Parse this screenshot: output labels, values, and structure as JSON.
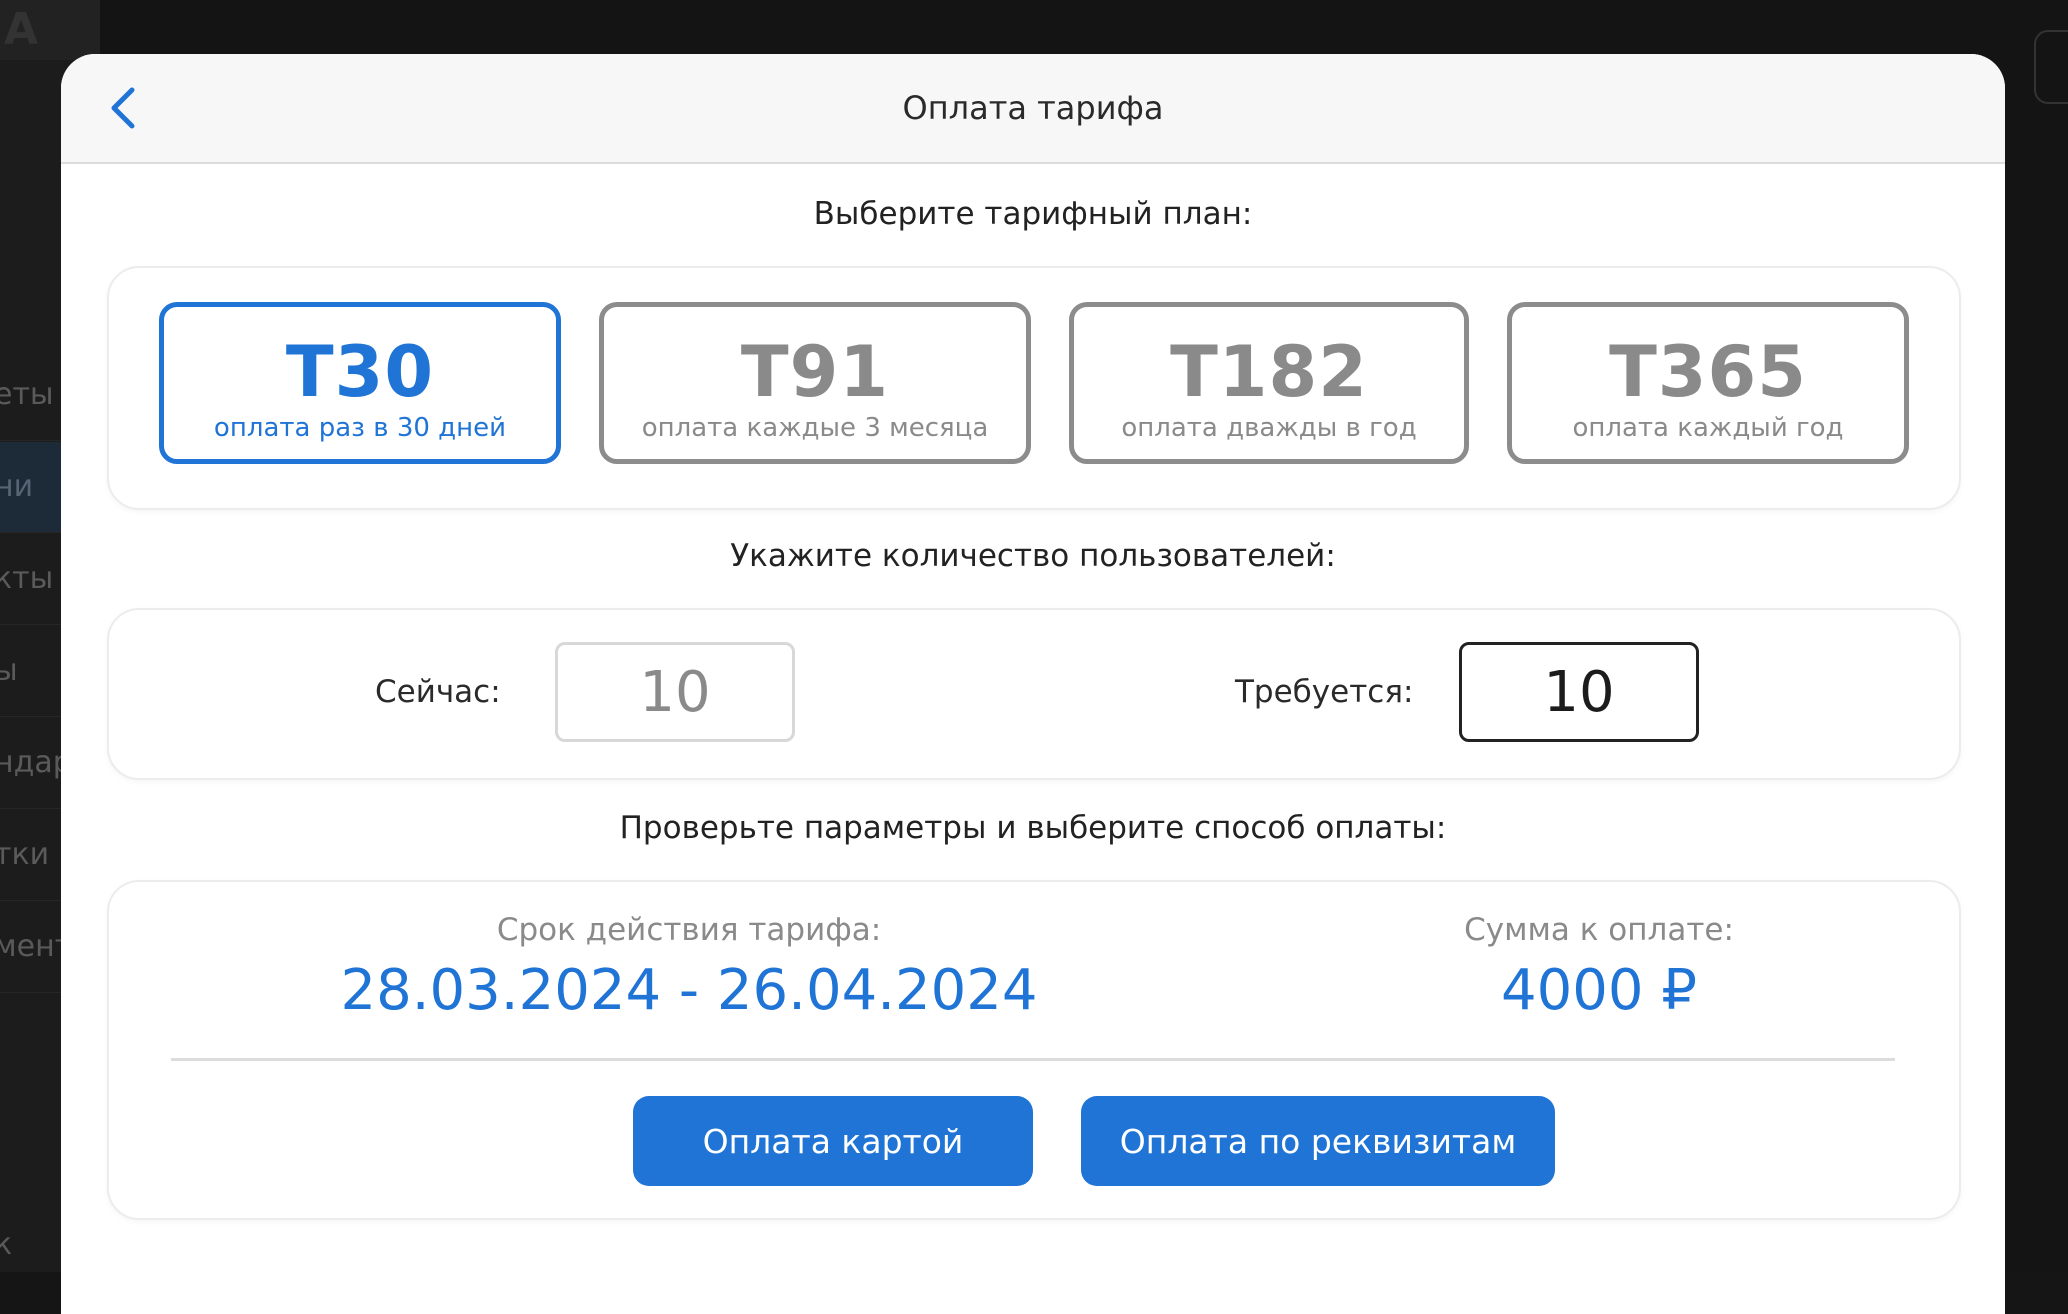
{
  "background": {
    "sidebar_items": [
      "еты",
      "ни",
      "кты",
      "ы",
      "ндар",
      "тки",
      "мент",
      "к"
    ]
  },
  "modal": {
    "title": "Оплата тарифа",
    "back_icon": "chevron-left-icon"
  },
  "plans": {
    "label": "Выберите тарифный план:",
    "selected": "T30",
    "items": [
      {
        "name": "T30",
        "desc": "оплата раз в 30 дней"
      },
      {
        "name": "T91",
        "desc": "оплата каждые 3 месяца"
      },
      {
        "name": "T182",
        "desc": "оплата дважды в год"
      },
      {
        "name": "T365",
        "desc": "оплата каждый год"
      }
    ]
  },
  "users": {
    "label": "Укажите количество пользователей:",
    "current_label": "Сейчас:",
    "current_value": "10",
    "required_label": "Требуется:",
    "required_value": "10"
  },
  "summary": {
    "label": "Проверьте параметры и выберите способ оплаты:",
    "period_label": "Срок действия тарифа:",
    "period_value": "28.03.2024 - 26.04.2024",
    "amount_label": "Сумма к оплате:",
    "amount_value": "4000 ₽"
  },
  "actions": {
    "pay_card": "Оплата картой",
    "pay_invoice": "Оплата по реквизитам"
  },
  "colors": {
    "accent": "#1f74d6",
    "inactive": "#8a8a8a"
  }
}
